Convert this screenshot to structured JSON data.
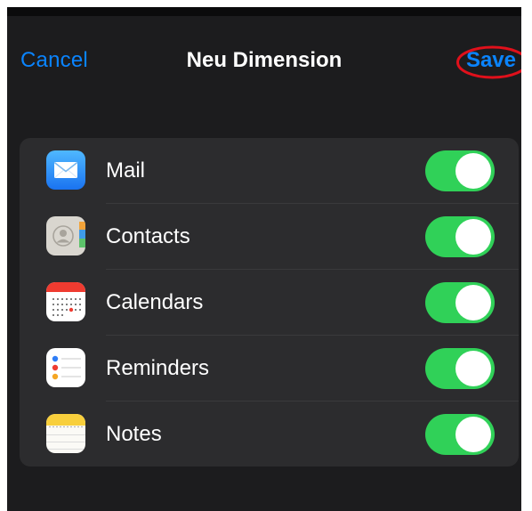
{
  "nav": {
    "cancel_label": "Cancel",
    "title": "Neu Dimension",
    "save_label": "Save"
  },
  "annotation_color": "#e0101b",
  "toggle_on_color": "#30d158",
  "accent_color": "#0a84ff",
  "items": [
    {
      "label": "Mail",
      "icon": "mail-icon",
      "enabled": true
    },
    {
      "label": "Contacts",
      "icon": "contacts-icon",
      "enabled": true
    },
    {
      "label": "Calendars",
      "icon": "calendar-icon",
      "enabled": true
    },
    {
      "label": "Reminders",
      "icon": "reminders-icon",
      "enabled": true
    },
    {
      "label": "Notes",
      "icon": "notes-icon",
      "enabled": true
    }
  ]
}
